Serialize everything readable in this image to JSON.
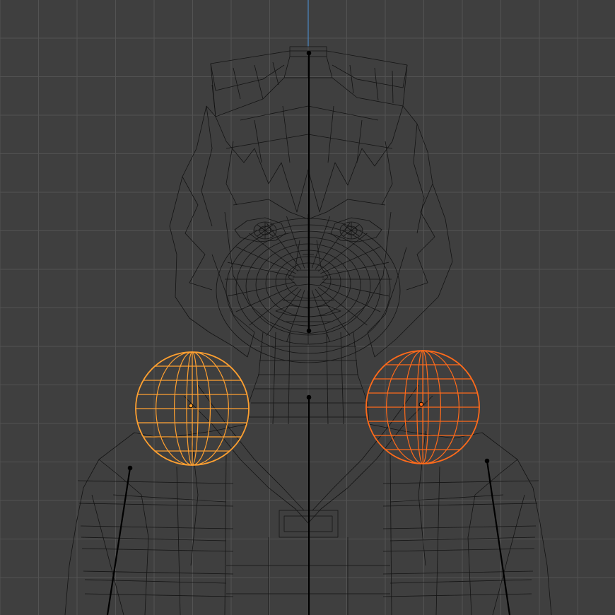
{
  "viewport": {
    "mode": "wireframe",
    "view": "front-orthographic",
    "grid": true,
    "background_color": "#3f3f3f",
    "grid_color": "#535353",
    "wire_color": "#141414",
    "axis_color": "#4b86c4",
    "selected_active_color": "#ff6a1a",
    "selected_color": "#ffa030",
    "bone_color": "#000000"
  },
  "scene": {
    "model": "character-head-and-torso",
    "selected_objects": [
      {
        "name": "left-shoulder-sphere",
        "state": "selected"
      },
      {
        "name": "right-shoulder-sphere",
        "state": "active"
      }
    ],
    "bones": [
      "spine",
      "head",
      "left-upper-arm",
      "right-upper-arm"
    ]
  }
}
